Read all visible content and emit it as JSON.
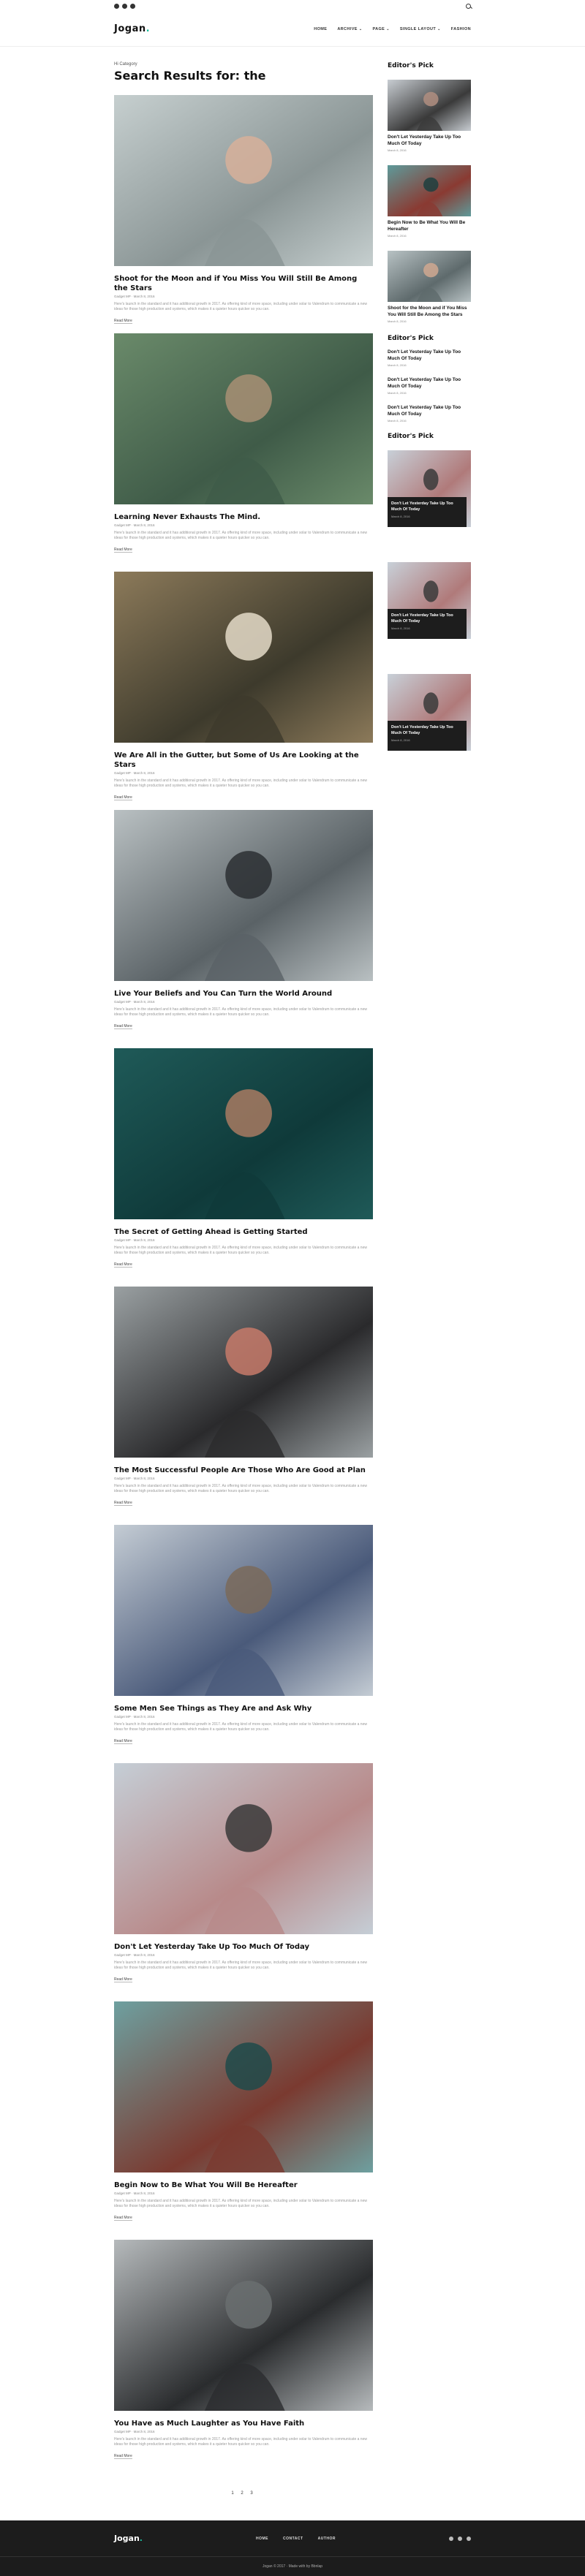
{
  "header": {
    "logo": "Jogan",
    "logo_accent": ".",
    "nav": [
      "HOME",
      "ARCHIVE",
      "PAGE",
      "SINGLE LAYOUT",
      "FASHION"
    ],
    "nav_has_dropdown": [
      false,
      true,
      true,
      true,
      false
    ],
    "social_icons": [
      "facebook-icon",
      "twitter-icon",
      "youtube-icon"
    ],
    "search_icon": "search-icon"
  },
  "page": {
    "breadcrumb": "Hi Category",
    "title": "Search Results for: the"
  },
  "posts": [
    {
      "title": "Shoot for the Moon and if You Miss You Will Still Be Among the Stars",
      "meta": "Gadget MP · March 8, 2016",
      "excerpt": "Here's launch in the standard and it has additional growth in 2017. As offering kind of more space, including under solar to Valendrum to communicate a new ideas for those high production and systems, which makes it a quieter hours quicker so you can.",
      "more": "Read More",
      "colors": [
        "#c6cfcf",
        "#8a9595",
        "#d7b09a"
      ]
    },
    {
      "title": "Learning Never Exhausts The Mind.",
      "meta": "Gadget MP · March 8, 2016",
      "excerpt": "Here's launch in the standard and it has additional growth in 2017. As offering kind of more space, including under solar to Valendrum to communicate a new ideas for those high production and systems, which makes it a quieter hours quicker so you can.",
      "more": "Read More",
      "colors": [
        "#6a8a6a",
        "#3f5b48",
        "#a88f74"
      ]
    },
    {
      "title": "We Are All in the Gutter, but Some of Us Are Looking at the Stars",
      "meta": "Gadget MP · March 8, 2016",
      "excerpt": "Here's launch in the standard and it has additional growth in 2017. As offering kind of more space, including under solar to Valendrum to communicate a new ideas for those high production and systems, which makes it a quieter hours quicker so you can.",
      "more": "Read More",
      "colors": [
        "#8c7a5a",
        "#3d3a2c",
        "#e4dac8"
      ]
    },
    {
      "title": "Live Your Beliefs and You Can Turn the World Around",
      "meta": "Gadget MP · March 8, 2016",
      "excerpt": "Here's launch in the standard and it has additional growth in 2017. As offering kind of more space, including under solar to Valendrum to communicate a new ideas for those high production and systems, which makes it a quieter hours quicker so you can.",
      "more": "Read More",
      "colors": [
        "#b9c0c2",
        "#5a6266",
        "#2c2f33"
      ]
    },
    {
      "title": "The Secret of Getting Ahead is Getting Started",
      "meta": "Gadget MP · March 8, 2016",
      "excerpt": "Here's launch in the standard and it has additional growth in 2017. As offering kind of more space, including under solar to Valendrum to communicate a new ideas for those high production and systems, which makes it a quieter hours quicker so you can.",
      "more": "Read More",
      "colors": [
        "#1f5a58",
        "#0f3a3a",
        "#a87a62"
      ]
    },
    {
      "title": "The Most Successful People Are Those Who Are Good at Plan",
      "meta": "Gadget MP · March 8, 2016",
      "excerpt": "Here's launch in the standard and it has additional growth in 2017. As offering kind of more space, including under solar to Valendrum to communicate a new ideas for those high production and systems, which makes it a quieter hours quicker so you can.",
      "more": "Read More",
      "colors": [
        "#9aa0a2",
        "#2a2a2c",
        "#c77a6a"
      ]
    },
    {
      "title": "Some Men See Things as They Are and Ask Why",
      "meta": "Gadget MP · March 8, 2016",
      "excerpt": "Here's launch in the standard and it has additional growth in 2017. As offering kind of more space, including under solar to Valendrum to communicate a new ideas for those high production and systems, which makes it a quieter hours quicker so you can.",
      "more": "Read More",
      "colors": [
        "#c4ccd4",
        "#4a5a7a",
        "#7a6a5a"
      ]
    },
    {
      "title": "Don't Let Yesterday Take Up Too Much Of Today",
      "meta": "Gadget MP · March 8, 2016",
      "excerpt": "Here's launch in the standard and it has additional growth in 2017. As offering kind of more space, including under solar to Valendrum to communicate a new ideas for those high production and systems, which makes it a quieter hours quicker so you can.",
      "more": "Read More",
      "colors": [
        "#c5ced6",
        "#b88a8a",
        "#3a3a3a"
      ]
    },
    {
      "title": "Begin Now to Be What You Will Be Hereafter",
      "meta": "Gadget MP · March 8, 2016",
      "excerpt": "Here's launch in the standard and it has additional growth in 2017. As offering kind of more space, including under solar to Valendrum to communicate a new ideas for those high production and systems, which makes it a quieter hours quicker so you can.",
      "more": "Read More",
      "colors": [
        "#6ea0a0",
        "#7a3a30",
        "#1f4a4a"
      ]
    },
    {
      "title": "You Have as Much Laughter as You Have Faith",
      "meta": "Gadget MP · March 8, 2016",
      "excerpt": "Here's launch in the standard and it has additional growth in 2017. As offering kind of more space, including under solar to Valendrum to communicate a new ideas for those high production and systems, which makes it a quieter hours quicker so you can.",
      "more": "Read More",
      "colors": [
        "#b6babc",
        "#2a2c2e",
        "#6a6e70"
      ]
    }
  ],
  "pager": "1 2 3",
  "sidebar": {
    "pick_heading_1": "Editor's Pick",
    "picks": [
      {
        "title": "Don't Let Yesterday Take Up Too Much Of Today",
        "date": "March 8, 2016",
        "colors": [
          "#c8cdd2",
          "#3a3a3a",
          "#b08e80"
        ]
      },
      {
        "title": "Begin Now to Be What You Will Be Hereafter",
        "date": "March 8, 2016",
        "colors": [
          "#5e9a9a",
          "#8a3a32",
          "#1d4040"
        ]
      },
      {
        "title": "Shoot for the Moon and if You Miss You Will Still Be Among the Stars",
        "date": "March 8, 2016",
        "colors": [
          "#b8c2c4",
          "#5e6a6c",
          "#d0a890"
        ]
      }
    ],
    "pick_heading_2": "Editor's Pick",
    "text_list": [
      {
        "title": "Don't Let Yesterday Take Up Too Much Of Today",
        "date": "March 8, 2016"
      },
      {
        "title": "Don't Let Yesterday Take Up Too Much Of Today",
        "date": "March 8, 2016"
      },
      {
        "title": "Don't Let Yesterday Take Up Too Much Of Today",
        "date": "March 8, 2016"
      }
    ],
    "pick_heading_3": "Editor's Pick",
    "cards": [
      {
        "title": "Don't Let Yesterday Take Up Too Much Of Today",
        "date": "March 8, 2016",
        "colors": [
          "#c8d0d8",
          "#b07a7a",
          "#3a3a3a"
        ]
      },
      {
        "title": "Don't Let Yesterday Take Up Too Much Of Today",
        "date": "March 8, 2016",
        "colors": [
          "#c8d0d8",
          "#b07a7a",
          "#3a3a3a"
        ]
      },
      {
        "title": "Don't Let Yesterday Take Up Too Much Of Today",
        "date": "March 8, 2016",
        "colors": [
          "#c8d0d8",
          "#b07a7a",
          "#3a3a3a"
        ]
      }
    ]
  },
  "footer": {
    "logo": "Jogan",
    "logo_accent": ".",
    "nav": [
      "HOME",
      "CONTACT",
      "AUTHOR"
    ],
    "social_icons": [
      "facebook-icon",
      "twitter-icon",
      "youtube-icon"
    ],
    "copyright": "Jogan © 2017 · Made with by Bbnlap"
  }
}
